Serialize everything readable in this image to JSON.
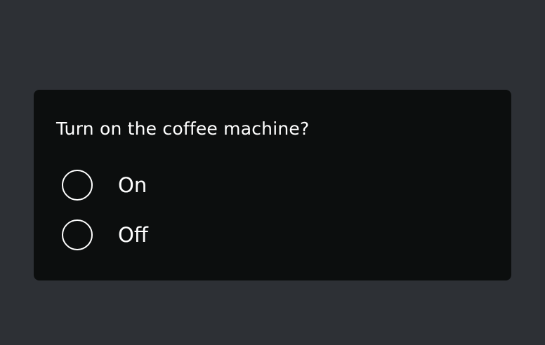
{
  "dialog": {
    "question": "Turn on the coffee machine?",
    "options": [
      {
        "label": "On",
        "selected": false
      },
      {
        "label": "Off",
        "selected": false
      }
    ]
  },
  "colors": {
    "page_background": "#2d3035",
    "card_background": "#0c0e0e",
    "text": "#ffffff"
  }
}
